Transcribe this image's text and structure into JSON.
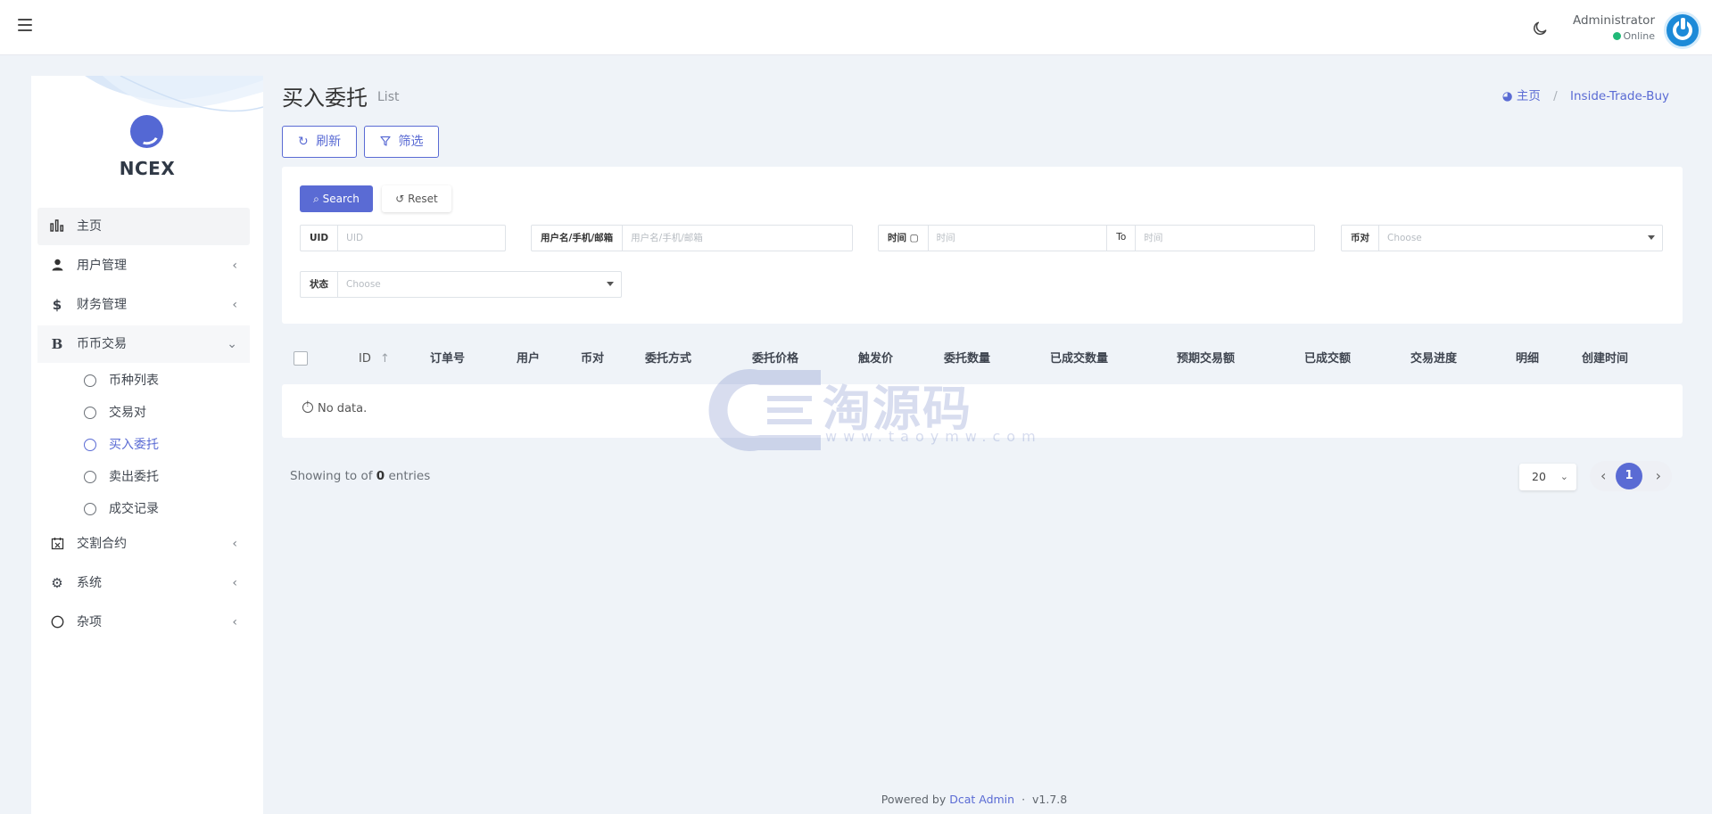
{
  "header": {
    "user_name": "Administrator",
    "user_status": "Online"
  },
  "sidebar": {
    "brand": "NCEX",
    "menu": [
      {
        "label": "主页",
        "icon": "bar-chart-icon"
      },
      {
        "label": "用户管理",
        "icon": "users-icon"
      },
      {
        "label": "财务管理",
        "icon": "dollar-icon"
      },
      {
        "label": "币币交易",
        "icon": "bitcoin-icon"
      },
      {
        "label": "交割合约",
        "icon": "calendar-x-icon"
      },
      {
        "label": "系统",
        "icon": "gear-icon"
      },
      {
        "label": "杂项",
        "icon": "circle-icon"
      }
    ],
    "submenu": [
      {
        "label": "币种列表"
      },
      {
        "label": "交易对"
      },
      {
        "label": "买入委托"
      },
      {
        "label": "卖出委托"
      },
      {
        "label": "成交记录"
      }
    ]
  },
  "page": {
    "title": "买入委托",
    "subtitle": "List",
    "breadcrumb_home": "主页",
    "breadcrumb_current": "Inside-Trade-Buy",
    "refresh_label": "刷新",
    "filter_label": "筛选"
  },
  "filter": {
    "search_label": "Search",
    "reset_label": "Reset",
    "uid_label": "UID",
    "uid_placeholder": "UID",
    "user_label": "用户名/手机/邮箱",
    "user_placeholder": "用户名/手机/邮箱",
    "time_label": "时间",
    "time_from_placeholder": "时间",
    "time_to_label": "To",
    "time_to_placeholder": "时间",
    "pair_label": "币对",
    "pair_value": "Choose",
    "status_label": "状态",
    "status_value": "Choose"
  },
  "table": {
    "columns": [
      "ID",
      "订单号",
      "用户",
      "币对",
      "委托方式",
      "委托价格",
      "触发价",
      "委托数量",
      "已成交数量",
      "预期交易额",
      "已成交额",
      "交易进度",
      "明细",
      "创建时间"
    ],
    "empty_text": "No data."
  },
  "pagination": {
    "showing_prefix": "Showing to of",
    "showing_count": "0",
    "showing_suffix": "entries",
    "per_page": "20",
    "current_page": "1"
  },
  "watermark": {
    "text": "淘源码",
    "url": "www.taoymw.com"
  },
  "footer": {
    "prefix": "Powered by",
    "link": "Dcat Admin",
    "sep": "·",
    "version": "v1.7.8"
  },
  "colors": {
    "accent": "#5a6bd4",
    "background": "#eff3f8",
    "online": "#21b978"
  }
}
